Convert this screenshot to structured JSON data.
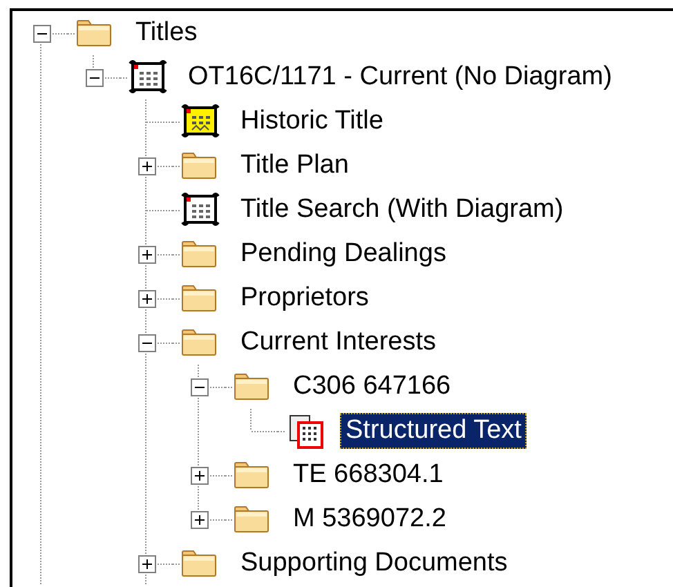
{
  "tree": [
    {
      "label": "Titles",
      "kind": "folder",
      "expanded": true,
      "selected": false,
      "children": [
        {
          "label": "OT16C/1171 - Current (No Diagram)",
          "kind": "title-document",
          "expanded": true,
          "selected": false,
          "children": [
            {
              "label": "Historic Title",
              "kind": "historic-document",
              "selected": false
            },
            {
              "label": "Title Plan",
              "kind": "folder",
              "expanded": false,
              "selected": false
            },
            {
              "label": "Title Search (With Diagram)",
              "kind": "title-document",
              "selected": false
            },
            {
              "label": "Pending Dealings",
              "kind": "folder",
              "expanded": false,
              "selected": false
            },
            {
              "label": "Proprietors",
              "kind": "folder",
              "expanded": false,
              "selected": false
            },
            {
              "label": "Current Interests",
              "kind": "folder",
              "expanded": true,
              "selected": false,
              "children": [
                {
                  "label": "C306 647166",
                  "kind": "folder",
                  "expanded": true,
                  "selected": false,
                  "children": [
                    {
                      "label": "Structured Text",
                      "kind": "structured-text",
                      "selected": true
                    }
                  ]
                },
                {
                  "label": "TE 668304.1",
                  "kind": "folder",
                  "expanded": false,
                  "selected": false
                },
                {
                  "label": "M 5369072.2",
                  "kind": "folder",
                  "expanded": false,
                  "selected": false
                }
              ]
            },
            {
              "label": "Supporting Documents",
              "kind": "folder",
              "expanded": false,
              "selected": false
            }
          ]
        }
      ]
    }
  ]
}
